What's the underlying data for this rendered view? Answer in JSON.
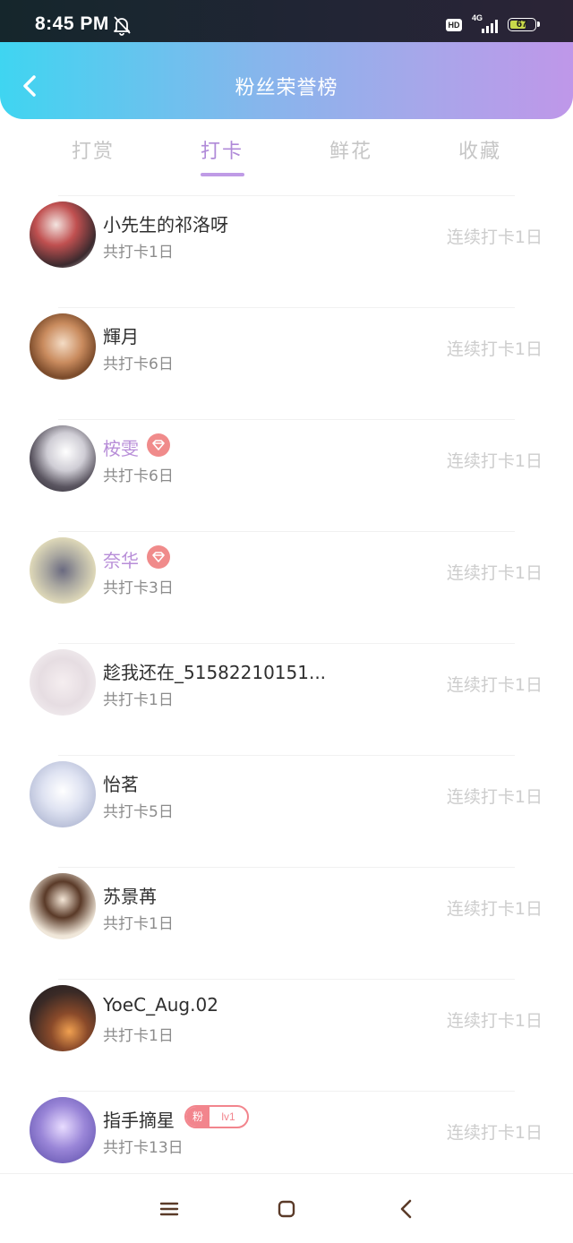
{
  "status_bar": {
    "time": "8:45 PM",
    "hd": "HD",
    "network": "4G",
    "battery": "67",
    "battery_level": 0.67,
    "icons": [
      "bell-off-icon",
      "signal-icon",
      "battery-icon"
    ]
  },
  "header": {
    "title": "粉丝荣誉榜",
    "back_icon": "chevron-left-icon"
  },
  "tabs": [
    {
      "label": "打赏",
      "active": false
    },
    {
      "label": "打卡",
      "active": true
    },
    {
      "label": "鲜花",
      "active": false
    },
    {
      "label": "收藏",
      "active": false
    }
  ],
  "list": [
    {
      "name": "小先生的祁洛呀",
      "total": "共打卡1日",
      "streak": "连续打卡1日",
      "vip": false,
      "badge": null
    },
    {
      "name": "輝月",
      "total": "共打卡6日",
      "streak": "连续打卡1日",
      "vip": false,
      "badge": null
    },
    {
      "name": "桉雯",
      "total": "共打卡6日",
      "streak": "连续打卡1日",
      "vip": true,
      "badge": "diamond-icon"
    },
    {
      "name": "奈华",
      "total": "共打卡3日",
      "streak": "连续打卡1日",
      "vip": true,
      "badge": "diamond-icon"
    },
    {
      "name": "趁我还在_51582210151...",
      "total": "共打卡1日",
      "streak": "连续打卡1日",
      "vip": false,
      "badge": null
    },
    {
      "name": "怡茗",
      "total": "共打卡5日",
      "streak": "连续打卡1日",
      "vip": false,
      "badge": null
    },
    {
      "name": "苏景苒",
      "total": "共打卡1日",
      "streak": "连续打卡1日",
      "vip": false,
      "badge": null
    },
    {
      "name": "YoeC_Aug.02",
      "total": "共打卡1日",
      "streak": "连续打卡1日",
      "vip": false,
      "badge": null
    },
    {
      "name": "指手摘星",
      "total": "共打卡13日",
      "streak": "连续打卡1日",
      "vip": false,
      "badge": "fan-level",
      "fan_badge": {
        "left": "粉",
        "right": "lv1"
      }
    }
  ],
  "bottom_nav": {
    "icons": [
      "menu-icon",
      "home-icon",
      "back-icon"
    ]
  },
  "colors": {
    "header_gradient_start": "#3fd5f1",
    "header_gradient_end": "#bf97e9",
    "active_tab": "#b08ad8",
    "vip_name": "#b88ed8",
    "badge": "#f08b8b"
  }
}
